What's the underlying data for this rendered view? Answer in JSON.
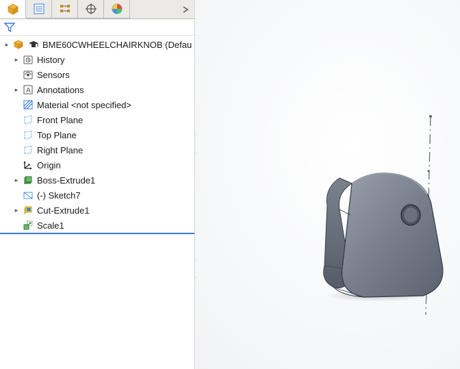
{
  "tabs": {
    "active_index": 0
  },
  "tree": {
    "root": {
      "label": "BME60CWHEELCHAIRKNOB (Defau"
    },
    "items": [
      {
        "label": "History",
        "icon": "history-icon",
        "expandable": true
      },
      {
        "label": "Sensors",
        "icon": "sensors-icon",
        "expandable": false
      },
      {
        "label": "Annotations",
        "icon": "annotations-icon",
        "expandable": true
      },
      {
        "label": "Material <not specified>",
        "icon": "material-icon",
        "expandable": false
      },
      {
        "label": "Front Plane",
        "icon": "plane-icon",
        "expandable": false
      },
      {
        "label": "Top Plane",
        "icon": "plane-icon",
        "expandable": false
      },
      {
        "label": "Right Plane",
        "icon": "plane-icon",
        "expandable": false
      },
      {
        "label": "Origin",
        "icon": "origin-icon",
        "expandable": false
      },
      {
        "label": "Boss-Extrude1",
        "icon": "boss-extrude-icon",
        "expandable": true
      },
      {
        "label": "(-) Sketch7",
        "icon": "sketch-icon",
        "expandable": false
      },
      {
        "label": "Cut-Extrude1",
        "icon": "cut-extrude-icon",
        "expandable": true
      },
      {
        "label": "Scale1",
        "icon": "scale-icon",
        "expandable": false
      }
    ]
  }
}
